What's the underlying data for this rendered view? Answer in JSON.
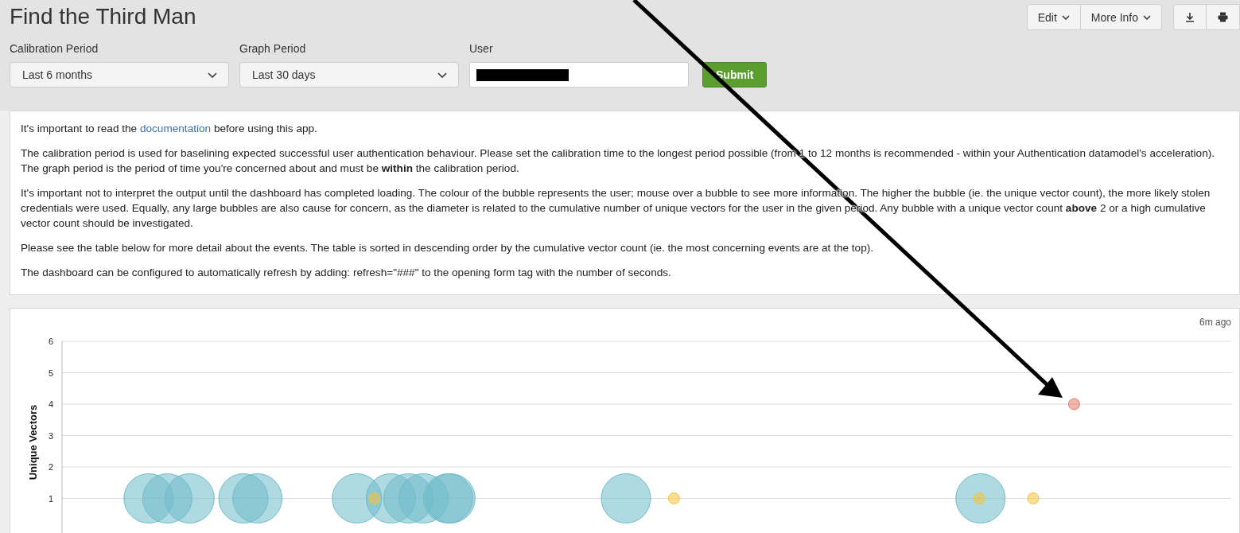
{
  "title": "Find the Third Man",
  "header_buttons": [
    {
      "kind": "menu",
      "label": "Edit"
    },
    {
      "kind": "menu",
      "label": "More Info"
    },
    {
      "kind": "download"
    },
    {
      "kind": "print"
    }
  ],
  "inputs": [
    {
      "kind": "dropdown",
      "label": "Calibration Period",
      "value": "Last 6 months"
    },
    {
      "kind": "dropdown",
      "label": "Graph Period",
      "value": "Last 30 days"
    },
    {
      "kind": "redacted",
      "label": "User"
    }
  ],
  "submit": "Submit",
  "intro": {
    "before": "It's important to read the ",
    "link": "documentation",
    "after": " before using this app."
  },
  "paragraphs": [
    "The calibration period is used for baselining expected successful user authentication behaviour. Please set the calibration time to the longest period possible (from 1 to 12 months is recommended - within your Authentication datamodel's acceleration). The graph period is the period of time you're concerned about and must be **within** the calibration period.",
    "It's important not to interpret the output until the dashboard has completed loading. The colour of the bubble represents the user; mouse over a bubble to see more information. The higher the bubble (ie. the unique vector count), the more likely stolen credentials were used. Equally, any large bubbles are also cause for concern, as the diameter is related to the cumulative number of unique vectors for the user in the given period. Any bubble with a unique vector count **above** 2 or a high cumulative vector count should be investigated.",
    "Please see the table below for more detail about the events. The table is sorted in descending order by the cumulative vector count (ie. the most concerning events are at the top).",
    "The dashboard can be configured to automatically refresh by adding: refresh=\"###\" to the opening form tag with the number of seconds."
  ],
  "chart": {
    "timestamp": "6m ago",
    "y_axis_title": "Unique Vectors",
    "y_ticks": [
      "6",
      "5",
      "4",
      "3",
      "2",
      "1"
    ]
  }
}
